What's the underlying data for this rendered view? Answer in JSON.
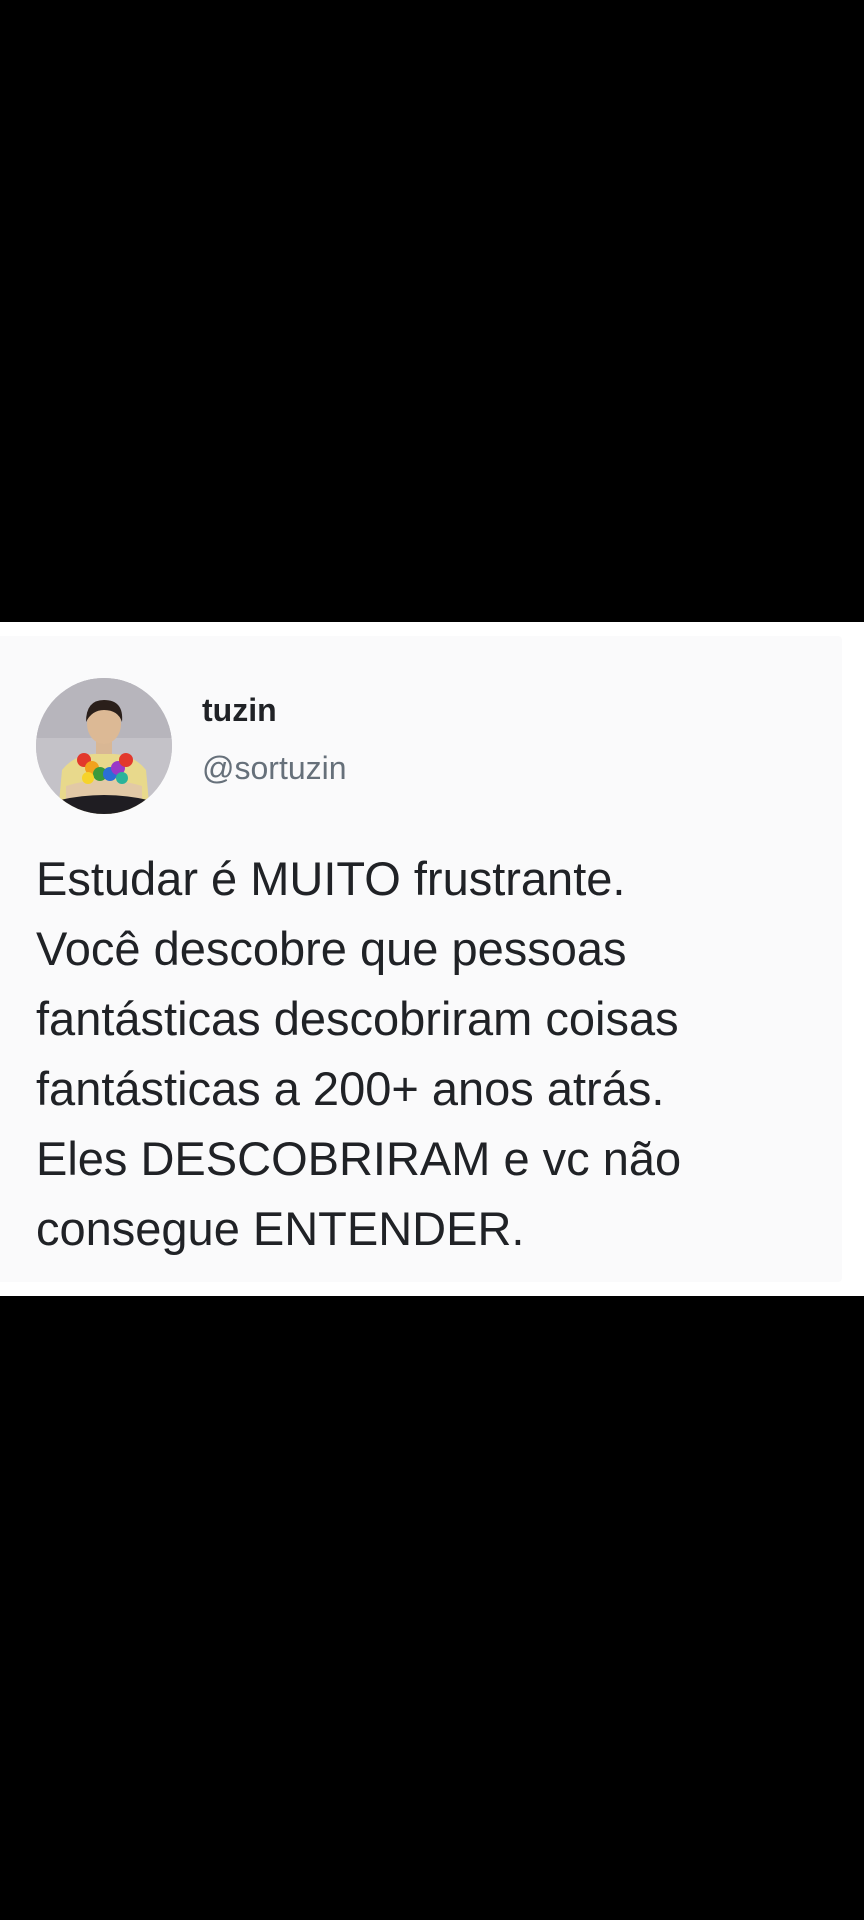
{
  "tweet": {
    "author": {
      "display_name": "tuzin",
      "handle": "@sortuzin",
      "avatar_icon": "profile-photo"
    },
    "text_lines": [
      "Estudar é MUITO frustrante.",
      "Você descobre que pessoas",
      "fantásticas descobriram coisas",
      "fantásticas a 200+ anos atrás.",
      "Eles DESCOBRIRAM e vc não",
      "consegue ENTENDER."
    ]
  },
  "colors": {
    "page_background": "#000000",
    "card_background": "#fafafb",
    "text_primary": "#202226",
    "text_secondary": "#66707a"
  }
}
